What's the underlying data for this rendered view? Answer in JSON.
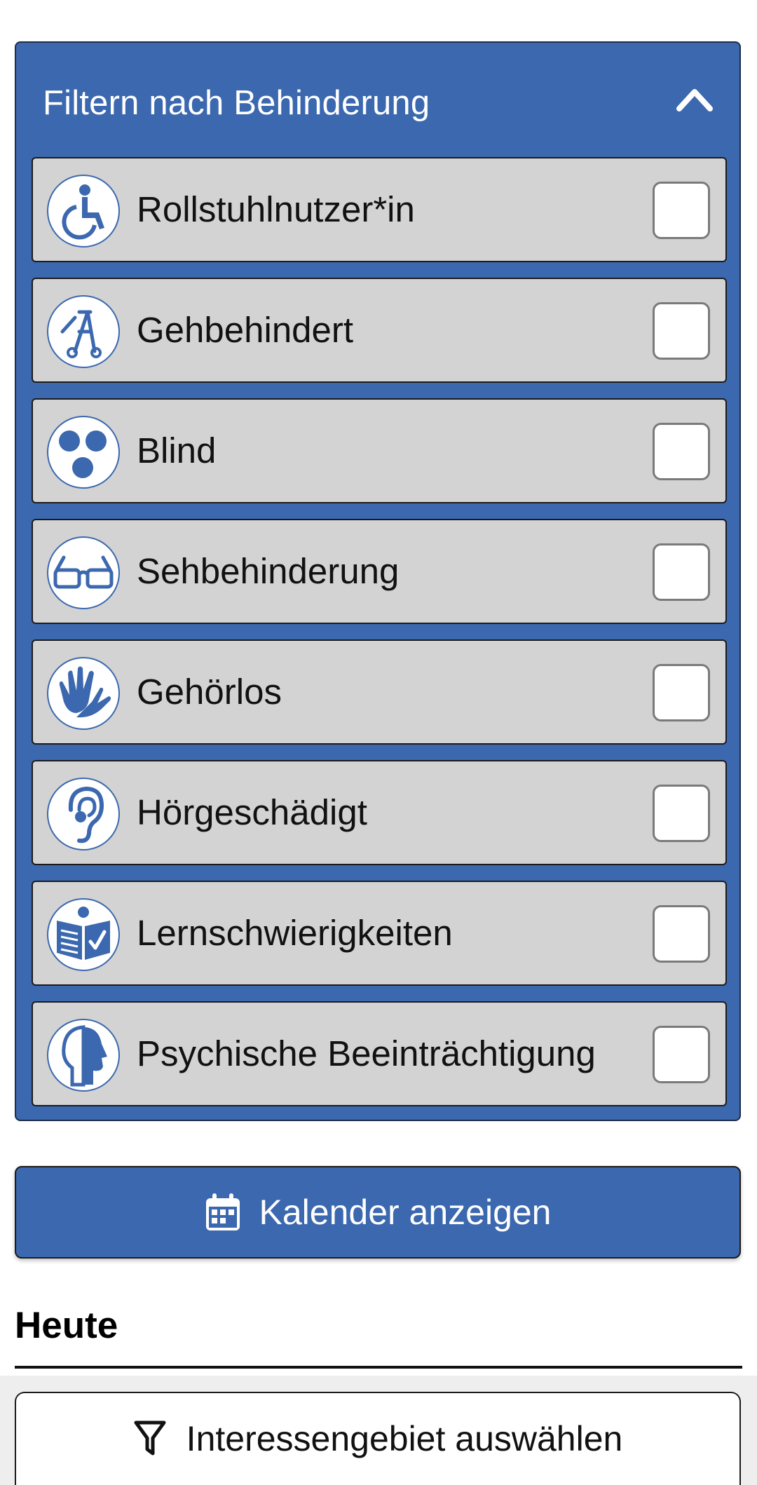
{
  "filter_panel": {
    "title": "Filtern nach Behinderung",
    "expanded": true,
    "items": [
      {
        "label": "Rollstuhlnutzer*in",
        "icon": "wheelchair-icon",
        "checked": false
      },
      {
        "label": "Gehbehindert",
        "icon": "walker-icon",
        "checked": false
      },
      {
        "label": "Blind",
        "icon": "blind-dots-icon",
        "checked": false
      },
      {
        "label": "Sehbehinderung",
        "icon": "glasses-icon",
        "checked": false
      },
      {
        "label": "Gehörlos",
        "icon": "sign-language-icon",
        "checked": false
      },
      {
        "label": "Hörgeschädigt",
        "icon": "ear-icon",
        "checked": false
      },
      {
        "label": "Lernschwierigkeiten",
        "icon": "easy-read-icon",
        "checked": false
      },
      {
        "label": "Psychische Beeinträchtigung",
        "icon": "head-profile-icon",
        "checked": false
      }
    ]
  },
  "calendar_button": {
    "label": "Kalender anzeigen",
    "icon": "calendar-icon"
  },
  "section": {
    "title": "Heute"
  },
  "interest_button": {
    "label": "Interessengebiet auswählen",
    "icon": "filter-funnel-icon"
  },
  "colors": {
    "primary": "#3b68ae",
    "item_background": "#d3d3d3",
    "text": "#111111"
  }
}
